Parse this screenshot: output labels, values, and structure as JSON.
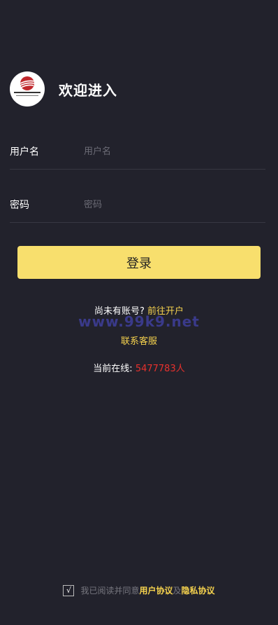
{
  "header": {
    "logo_icon": "company-logo",
    "title": "欢迎进入"
  },
  "form": {
    "username_label": "用户名",
    "username_placeholder": "用户名",
    "password_label": "密码",
    "password_placeholder": "密码"
  },
  "login": {
    "button_label": "登录"
  },
  "register": {
    "prompt": "尚未有账号?",
    "link": "前往开户"
  },
  "watermark": "www.99k9.net",
  "contact": {
    "link": "联系客服"
  },
  "online": {
    "label": "当前在线:",
    "count": "5477783人"
  },
  "agreement": {
    "checkbox_mark": "√",
    "text": "我已阅读并同意",
    "user_link": "用户协议",
    "conjunction": "及",
    "privacy_link": "隐私协议"
  },
  "colors": {
    "background": "#22222c",
    "accent": "#f8df6d",
    "link": "#f5d24e",
    "count": "#e8312d"
  }
}
